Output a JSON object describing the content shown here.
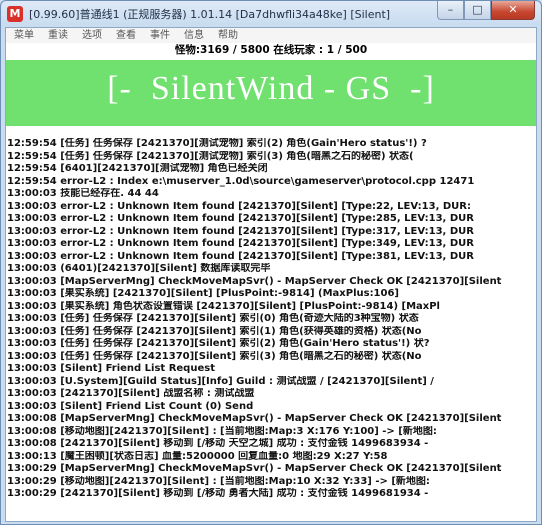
{
  "window": {
    "title": "[0.99.60]普通线1 (正规服务器) 1.01.14 [Da7dhwfli34a48ke] [Silent]",
    "controls": {
      "minimize": "–",
      "maximize": "□",
      "close": "✕"
    }
  },
  "menu": {
    "items": [
      "菜单",
      "重读",
      "选项",
      "查看",
      "事件",
      "信息",
      "帮助"
    ]
  },
  "stats": {
    "text": "怪物:3169 / 5800 在线玩家 : 1 / 500"
  },
  "banner": {
    "text": "[-  SilentWind - GS  -]",
    "color": "#70e06e"
  },
  "log": {
    "lines": [
      "12:59:54 [任务] 任务保存 [2421370][测试宠物] 索引(2) 角色(Gain'Hero status'!) ?",
      "12:59:54 [任务] 任务保存 [2421370][测试宠物] 索引(3) 角色(暗黑之石的秘密) 状态(",
      "12:59:54 [6401][2421370][测试宠物] 角色已经关闭",
      "12:59:54 error-L2 : Index e:\\muserver_1.0d\\source\\gameserver\\protocol.cpp 12471",
      "13:00:03 技能已经存在. 44 44",
      "13:00:03 error-L2 : Unknown Item found [2421370][Silent] [Type:22, LEV:13, DUR:",
      "13:00:03 error-L2 : Unknown Item found [2421370][Silent] [Type:285, LEV:13, DUR",
      "13:00:03 error-L2 : Unknown Item found [2421370][Silent] [Type:317, LEV:13, DUR",
      "13:00:03 error-L2 : Unknown Item found [2421370][Silent] [Type:349, LEV:13, DUR",
      "13:00:03 error-L2 : Unknown Item found [2421370][Silent] [Type:381, LEV:13, DUR",
      "13:00:03 (6401)[2421370][Silent] 数据库读取完毕",
      "13:00:03 [MapServerMng] CheckMoveMapSvr() - MapServer Check OK [2421370][Silent",
      "13:00:03 [果实系统] [2421370][Silent] [PlusPoint:-9814] (MaxPlus:106]",
      "13:00:03 [果实系统] 角色状态设置错误 [2421370][Silent] [PlusPoint:-9814) [MaxPl",
      "13:00:03 [任务] 任务保存 [2421370][Silent] 索引(0) 角色(奇迹大陆的3种宝物) 状态",
      "13:00:03 [任务] 任务保存 [2421370][Silent] 索引(1) 角色(获得英雄的资格) 状态(No",
      "13:00:03 [任务] 任务保存 [2421370][Silent] 索引(2) 角色(Gain'Hero status'!) 状?",
      "13:00:03 [任务] 任务保存 [2421370][Silent] 索引(3) 角色(暗黑之石的秘密) 状态(No",
      "13:00:03 [Silent] Friend List Request",
      "13:00:03 [U.System][Guild Status][Info] Guild : 测试战盟 / [2421370][Silent] /",
      "13:00:03 [2421370][Silent] 战盟名称 : 测试战盟",
      "13:00:03 [Silent] Friend List Count (0) Send",
      "13:00:08 [MapServerMng] CheckMoveMapSvr() - MapServer Check OK [2421370][Silent",
      "13:00:08 [移动地图][2421370][Silent] : [当前地图:Map:3 X:176 Y:100] -> [新地图:",
      "13:00:08 [2421370][Silent] 移动到 [/移动 天空之城] 成功 : 支付金钱 1499683934 -",
      "13:00:13 [魔王困顿][状态日志] 血量:5200000 回复血量:0 地图:29 X:27 Y:58",
      "13:00:29 [MapServerMng] CheckMoveMapSvr() - MapServer Check OK [2421370][Silent",
      "13:00:29 [移动地图][2421370][Silent] : [当前地图:Map:10 X:32 Y:33] -> [新地图:",
      "13:00:29 [2421370][Silent] 移动到 [/移动 勇者大陆] 成功 : 支付金钱 1499681934 -"
    ]
  }
}
